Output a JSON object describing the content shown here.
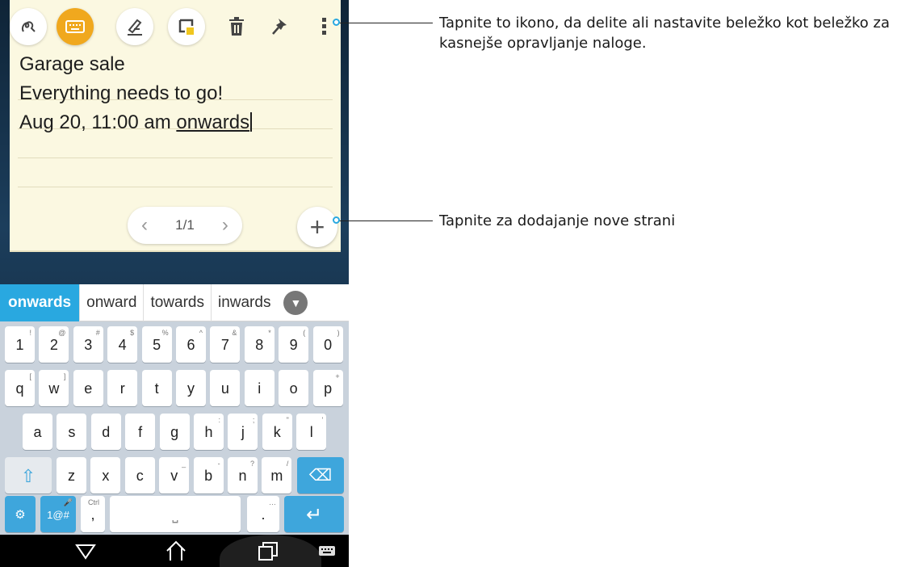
{
  "note": {
    "lines": [
      "Garage sale",
      "Everything needs to go!",
      "Aug 20, 11:00 am "
    ],
    "underlined_word": "onwards",
    "pager": {
      "label": "1/1",
      "prev": "‹",
      "next": "›"
    },
    "add_label": "+"
  },
  "toolbar": {
    "icons": [
      "handwriting-icon",
      "keyboard-icon",
      "pen-icon",
      "sticky-note-icon",
      "trash-icon",
      "pin-icon",
      "more-icon"
    ],
    "accent_color": "#f0a81e"
  },
  "keyboard": {
    "suggestions": [
      "onwards",
      "onward",
      "towards",
      "inwards"
    ],
    "number_row": [
      "1",
      "2",
      "3",
      "4",
      "5",
      "6",
      "7",
      "8",
      "9",
      "0"
    ],
    "number_hints": [
      "!",
      "@",
      "#",
      "$",
      "%",
      "^",
      "&",
      "*",
      "(",
      ")"
    ],
    "row1": [
      "q",
      "w",
      "e",
      "r",
      "t",
      "y",
      "u",
      "i",
      "o",
      "p"
    ],
    "row1_hints": [
      "[",
      "]",
      "",
      "",
      "",
      "",
      "",
      "",
      "",
      "+"
    ],
    "row2": [
      "a",
      "s",
      "d",
      "f",
      "g",
      "h",
      "j",
      "k",
      "l"
    ],
    "row2_hints": [
      "",
      "",
      "",
      "",
      "",
      ":",
      ";",
      "\"",
      "'"
    ],
    "row3": [
      "z",
      "x",
      "c",
      "v",
      "b",
      "n",
      "m"
    ],
    "row3_hints": [
      "",
      "",
      "",
      "_",
      "-",
      "?",
      "/"
    ],
    "sym_label": "1@#",
    "ctrl_label": "Ctrl",
    "comma": ",",
    "period": ".",
    "period_hint": "…",
    "accent_color": "#3ea6dc"
  },
  "callouts": {
    "menu": "Tapnite to ikono, da delite ali nastavite beležko kot beležko za kasnejše opravljanje naloge.",
    "add_page": "Tapnite za dodajanje nove strani"
  }
}
